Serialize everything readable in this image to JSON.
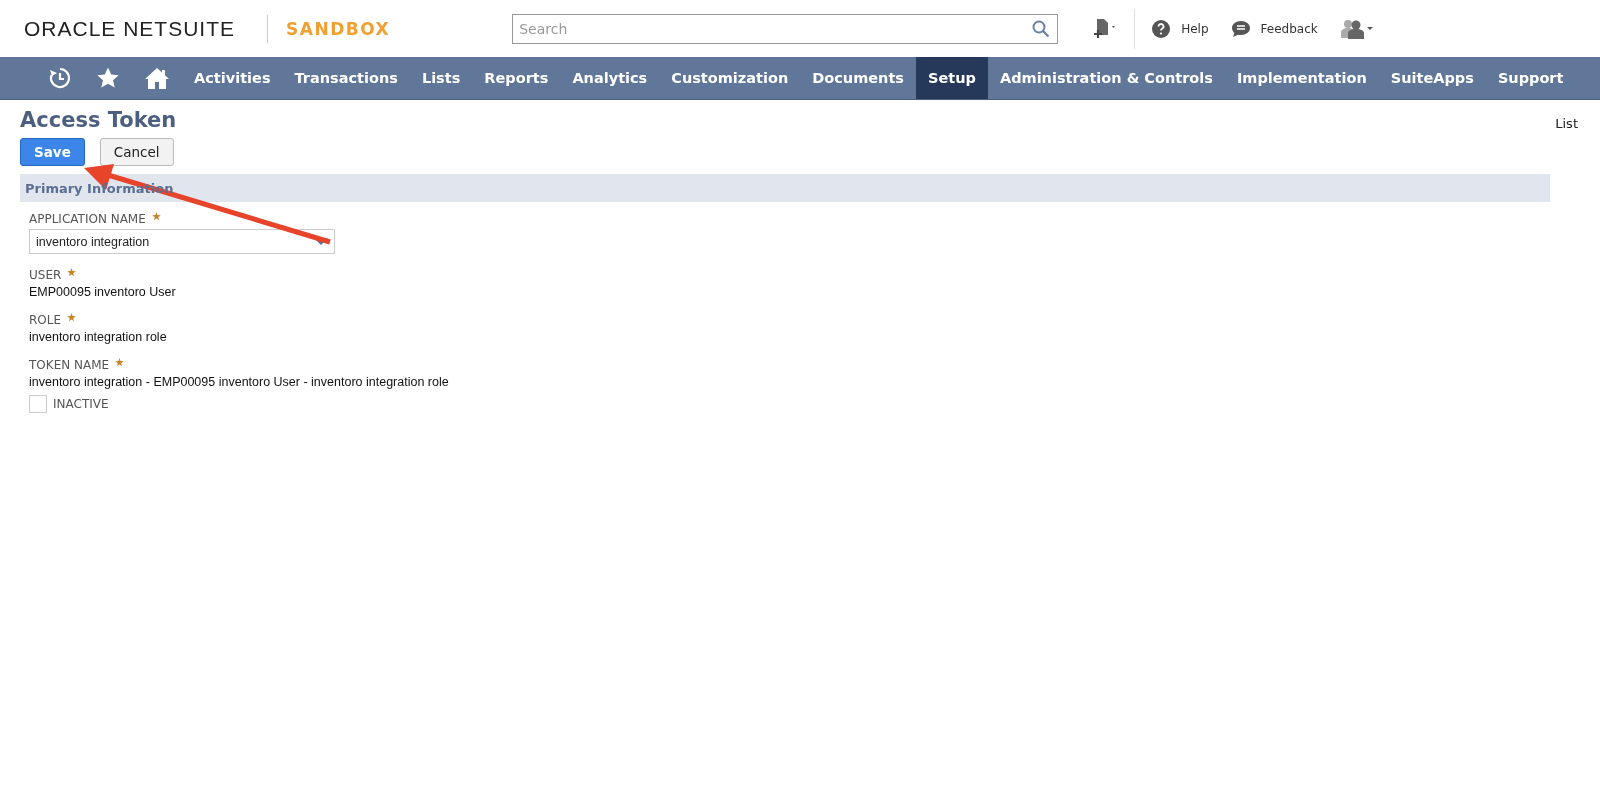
{
  "header": {
    "brand": "ORACLE NETSUITE",
    "environment": "SANDBOX",
    "search": {
      "placeholder": "Search"
    },
    "links": [
      "Help",
      "Feedback"
    ]
  },
  "nav": {
    "items": [
      {
        "label": "Activities",
        "selected": false
      },
      {
        "label": "Transactions",
        "selected": false
      },
      {
        "label": "Lists",
        "selected": false
      },
      {
        "label": "Reports",
        "selected": false
      },
      {
        "label": "Analytics",
        "selected": false
      },
      {
        "label": "Customization",
        "selected": false
      },
      {
        "label": "Documents",
        "selected": false
      },
      {
        "label": "Setup",
        "selected": true
      },
      {
        "label": "Administration & Controls",
        "selected": false
      },
      {
        "label": "Implementation",
        "selected": false
      },
      {
        "label": "SuiteApps",
        "selected": false
      },
      {
        "label": "Support",
        "selected": false
      }
    ]
  },
  "page": {
    "title": "Access Token",
    "list_link": "List",
    "buttons": [
      {
        "label": "Save",
        "kind": "primary"
      },
      {
        "label": "Cancel",
        "kind": "secondary"
      }
    ]
  },
  "section": {
    "title": "Primary Information"
  },
  "fields": [
    {
      "kind": "select",
      "label": "APPLICATION NAME",
      "required": true,
      "value": "inventoro integration"
    },
    {
      "kind": "text",
      "label": "USER",
      "required": true,
      "value": "EMP00095 inventoro User"
    },
    {
      "kind": "text",
      "label": "ROLE",
      "required": true,
      "value": "inventoro integration role"
    },
    {
      "kind": "text",
      "label": "TOKEN NAME",
      "required": true,
      "value": "inventoro integration - EMP00095 inventoro User -  inventoro integration role"
    }
  ],
  "inactive": {
    "label": "INACTIVE",
    "checked": false
  }
}
